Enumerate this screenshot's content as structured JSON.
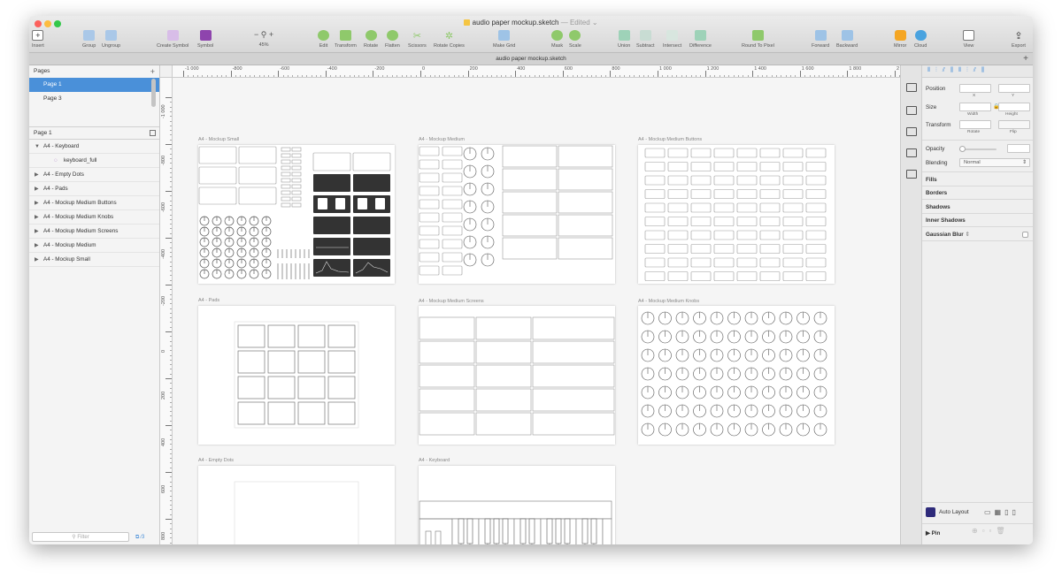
{
  "window": {
    "title": "audio paper mockup.sketch",
    "title_status": "— Edited",
    "document_tab": "audio paper mockup.sketch",
    "add_tab": "+"
  },
  "toolbar": {
    "insert": "Insert",
    "group": "Group",
    "ungroup": "Ungroup",
    "create_symbol": "Create Symbol",
    "symbol": "Symbol",
    "zoom_minus": "−",
    "zoom_plus": "+",
    "zoom_value": "45%",
    "edit": "Edit",
    "transform": "Transform",
    "rotate": "Rotate",
    "flatten": "Flatten",
    "scissors": "Scissors",
    "rotate_copies": "Rotate Copies",
    "make_grid": "Make Grid",
    "mask": "Mask",
    "scale": "Scale",
    "union": "Union",
    "subtract": "Subtract",
    "intersect": "Intersect",
    "difference": "Difference",
    "round_to_pixel": "Round To Pixel",
    "forward": "Forward",
    "backward": "Backward",
    "mirror": "Mirror",
    "cloud": "Cloud",
    "view": "View",
    "export": "Export"
  },
  "pages_panel": {
    "header": "Pages",
    "add": "+",
    "pages": [
      "Page 1",
      "Page 3"
    ],
    "selected_page": "Page 1"
  },
  "layers_panel": {
    "header": "Page 1",
    "layers": [
      {
        "name": "A4 - Keyboard",
        "expanded": true
      },
      {
        "name": "keyboard_full",
        "child": true
      },
      {
        "name": "A4 - Empty Dots"
      },
      {
        "name": "A4 - Pads"
      },
      {
        "name": "A4 - Mockup Medium Buttons"
      },
      {
        "name": "A4 - Mockup Medium Knobs"
      },
      {
        "name": "A4 - Mockup Medium Screens"
      },
      {
        "name": "A4 - Mockup Medium"
      },
      {
        "name": "A4 - Mockup Small"
      }
    ],
    "filter_placeholder": "Filter",
    "filter_count": "3"
  },
  "rulers": {
    "top_ticks": [
      "-1 000",
      "-800",
      "-600",
      "-400",
      "-200",
      "0",
      "200",
      "400",
      "600",
      "800",
      "1 000",
      "1 200",
      "1 400",
      "1 600",
      "1 800",
      "2 000"
    ],
    "left_ticks": [
      "-1 000",
      "-800",
      "-600",
      "-400",
      "-200",
      "0",
      "200",
      "400",
      "600",
      "800"
    ]
  },
  "artboards": {
    "mockup_small": "A4 - Mockup Small",
    "mockup_medium": "A4 - Mockup Medium",
    "mockup_medium_buttons": "A4 - Mockup Medium Buttons",
    "pads": "A4 - Pads",
    "mockup_medium_screens": "A4 - Mockup Medium Screens",
    "mockup_medium_knobs": "A4 - Mockup Medium Knobs",
    "empty_dots": "A4 - Empty Dots",
    "keyboard": "A4 - Keyboard"
  },
  "inspector": {
    "position": "Position",
    "x": "X",
    "y": "Y",
    "size": "Size",
    "width": "Width",
    "height": "Height",
    "transform": "Transform",
    "rotate": "Rotate",
    "flip": "Flip",
    "opacity": "Opacity",
    "blending": "Blending",
    "blending_value": "Normal",
    "fills": "Fills",
    "borders": "Borders",
    "shadows": "Shadows",
    "inner_shadows": "Inner Shadows",
    "gaussian_blur": "Gaussian Blur",
    "auto_layout": "Auto Layout",
    "pin": "Pin"
  },
  "colors": {
    "selection": "#4a90d9",
    "close": "#fc605c",
    "minimize": "#fdbc40",
    "zoom": "#34c84a",
    "symbol_purple": "#8e44ad",
    "dark_module": "#333333"
  }
}
